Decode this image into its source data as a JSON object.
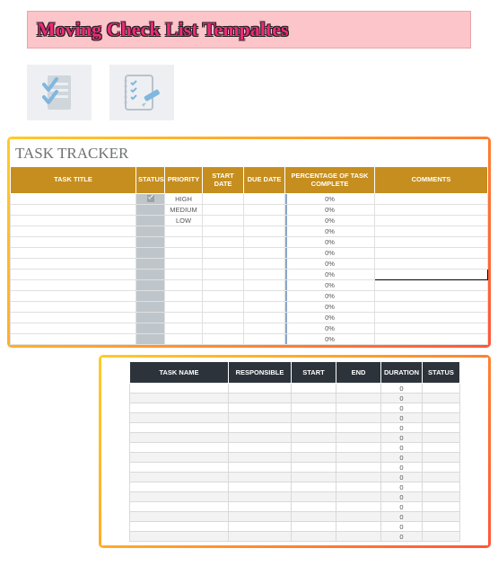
{
  "banner": {
    "title": "Moving Check List Tempaltes"
  },
  "thumbs": [
    {
      "icon": "checklist-clipboard"
    },
    {
      "icon": "notebook-pencil"
    }
  ],
  "tracker": {
    "title": "TASK TRACKER",
    "columns": {
      "task_title": "TASK TITLE",
      "status": "STATUS",
      "priority": "PRIORITY",
      "start_date": "START DATE",
      "due_date": "DUE DATE",
      "pct_complete": "PERCENTAGE OF TASK COMPLETE",
      "comments": "COMMENTS"
    },
    "rows": [
      {
        "task": "",
        "status": "checked",
        "priority": "HIGH",
        "start": "",
        "due": "",
        "pct": "0%",
        "comments": ""
      },
      {
        "task": "",
        "status": "",
        "priority": "MEDIUM",
        "start": "",
        "due": "",
        "pct": "0%",
        "comments": ""
      },
      {
        "task": "",
        "status": "",
        "priority": "LOW",
        "start": "",
        "due": "",
        "pct": "0%",
        "comments": ""
      },
      {
        "task": "",
        "status": "",
        "priority": "",
        "start": "",
        "due": "",
        "pct": "0%",
        "comments": ""
      },
      {
        "task": "",
        "status": "",
        "priority": "",
        "start": "",
        "due": "",
        "pct": "0%",
        "comments": ""
      },
      {
        "task": "",
        "status": "",
        "priority": "",
        "start": "",
        "due": "",
        "pct": "0%",
        "comments": ""
      },
      {
        "task": "",
        "status": "",
        "priority": "",
        "start": "",
        "due": "",
        "pct": "0%",
        "comments": ""
      },
      {
        "task": "",
        "status": "",
        "priority": "",
        "start": "",
        "due": "",
        "pct": "0%",
        "comments": "",
        "marked": true
      },
      {
        "task": "",
        "status": "",
        "priority": "",
        "start": "",
        "due": "",
        "pct": "0%",
        "comments": ""
      },
      {
        "task": "",
        "status": "",
        "priority": "",
        "start": "",
        "due": "",
        "pct": "0%",
        "comments": ""
      },
      {
        "task": "",
        "status": "",
        "priority": "",
        "start": "",
        "due": "",
        "pct": "0%",
        "comments": ""
      },
      {
        "task": "",
        "status": "",
        "priority": "",
        "start": "",
        "due": "",
        "pct": "0%",
        "comments": ""
      },
      {
        "task": "",
        "status": "",
        "priority": "",
        "start": "",
        "due": "",
        "pct": "0%",
        "comments": ""
      },
      {
        "task": "",
        "status": "",
        "priority": "",
        "start": "",
        "due": "",
        "pct": "0%",
        "comments": ""
      }
    ]
  },
  "plan": {
    "columns": {
      "task_name": "TASK NAME",
      "responsible": "RESPONSIBLE",
      "start": "START",
      "end": "END",
      "duration": "DURATION",
      "status": "STATUS"
    },
    "rows": [
      {
        "task": "",
        "responsible": "",
        "start": "",
        "end": "",
        "duration": "0",
        "status": ""
      },
      {
        "task": "",
        "responsible": "",
        "start": "",
        "end": "",
        "duration": "0",
        "status": ""
      },
      {
        "task": "",
        "responsible": "",
        "start": "",
        "end": "",
        "duration": "0",
        "status": ""
      },
      {
        "task": "",
        "responsible": "",
        "start": "",
        "end": "",
        "duration": "0",
        "status": ""
      },
      {
        "task": "",
        "responsible": "",
        "start": "",
        "end": "",
        "duration": "0",
        "status": ""
      },
      {
        "task": "",
        "responsible": "",
        "start": "",
        "end": "",
        "duration": "0",
        "status": ""
      },
      {
        "task": "",
        "responsible": "",
        "start": "",
        "end": "",
        "duration": "0",
        "status": ""
      },
      {
        "task": "",
        "responsible": "",
        "start": "",
        "end": "",
        "duration": "0",
        "status": ""
      },
      {
        "task": "",
        "responsible": "",
        "start": "",
        "end": "",
        "duration": "0",
        "status": ""
      },
      {
        "task": "",
        "responsible": "",
        "start": "",
        "end": "",
        "duration": "0",
        "status": ""
      },
      {
        "task": "",
        "responsible": "",
        "start": "",
        "end": "",
        "duration": "0",
        "status": ""
      },
      {
        "task": "",
        "responsible": "",
        "start": "",
        "end": "",
        "duration": "0",
        "status": ""
      },
      {
        "task": "",
        "responsible": "",
        "start": "",
        "end": "",
        "duration": "0",
        "status": ""
      },
      {
        "task": "",
        "responsible": "",
        "start": "",
        "end": "",
        "duration": "0",
        "status": ""
      },
      {
        "task": "",
        "responsible": "",
        "start": "",
        "end": "",
        "duration": "0",
        "status": ""
      },
      {
        "task": "",
        "responsible": "",
        "start": "",
        "end": "",
        "duration": "0",
        "status": ""
      }
    ]
  }
}
